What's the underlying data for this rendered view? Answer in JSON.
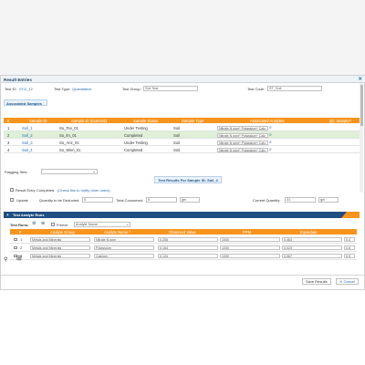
{
  "window": {
    "title": "Result Entries",
    "close": "✕"
  },
  "header": {
    "test_id_label": "Test ID:",
    "test_id_value": "STG_12",
    "test_type_label": "Test Type:",
    "test_type_value": "Quantitative",
    "test_group_label": "Test Group:",
    "test_group_value": "Soil Test",
    "test_code_label": "Test Code:",
    "test_code_value": "ST_Soil"
  },
  "associated_samples": {
    "title": "Associated Samples",
    "columns": [
      "#",
      "Sample ID",
      "Sample ID (External)",
      "Sample Status",
      "Sample Type",
      "Associated Analytes",
      "QC Sample?"
    ],
    "rows": [
      {
        "n": "1",
        "id": "Soil_1",
        "ext": "So_Tex_01",
        "status": "Under Testing",
        "type": "Soil",
        "analytes": "Nitrate N ppm* Potassium* Calc"
      },
      {
        "n": "2",
        "id": "Soil_2",
        "ext": "So_lm_01",
        "status": "Completed",
        "type": "Soil",
        "analytes": "Nitrate N ppm* Potassium* Calc"
      },
      {
        "n": "3",
        "id": "Soil_3",
        "ext": "So_Ariz_01",
        "status": "Under Testing",
        "type": "Soil",
        "analytes": "Nitrate N ppm* Potassium* Calc"
      },
      {
        "n": "4",
        "id": "Soil_4",
        "ext": "So_Minn_01",
        "status": "Completed",
        "type": "Soil",
        "analytes": "Nitrate N ppm* Potassium* Calc"
      }
    ]
  },
  "flagging": {
    "label": "Flagging Sets"
  },
  "results_for": "Test Results For Sample ID: Soil_2",
  "result_completed": {
    "label": "Result Entry Completed",
    "link": "(Check this to notify other users)"
  },
  "quantity": {
    "update_label": "Update",
    "deducted_label": "Quantity to be Deducted:",
    "deducted_value": "0",
    "consumed_label": "Total Consumed:",
    "consumed_value": "0",
    "unit": "gm",
    "current_label": "Current Quantity:",
    "current_value": "31"
  },
  "analyte_runs": {
    "title": "Test Analyte Runs",
    "test_runs_label": "Test Runs:",
    "run_value": "1",
    "freeze_label": "Freeze",
    "freeze_placeholder": "Analyte Name",
    "columns": [
      "#",
      "Analyte Group",
      "Analyte Name *",
      "Observed Value",
      "PPM",
      "Equivdate"
    ],
    "rows": [
      {
        "n": "1",
        "group": "Metals and Minerals",
        "name": "Nitrate N ppm",
        "observed": "0.256",
        "ppm": "1000",
        "equiv": "0.464",
        "extra": "0.4"
      },
      {
        "n": "2",
        "group": "Metals and Minerals",
        "name": "Potassium",
        "observed": "0.164",
        "ppm": "1000",
        "equiv": "0.023",
        "extra": "0.6"
      },
      {
        "n": "3",
        "group": "Metals and Minerals",
        "name": "Calcium",
        "observed": "0.124",
        "ppm": "1000",
        "equiv": "0.567",
        "extra": "5.5"
      }
    ]
  },
  "footer": {
    "save": "Save Results",
    "cancel": "✕ Cancel"
  },
  "icons": {
    "search": "⌕",
    "close": "✕",
    "plus": "+"
  },
  "colors": {
    "accent": "#f7941d",
    "brand": "#1f4f82",
    "link": "#2a6db5",
    "selected_row": "#dff0d8"
  }
}
